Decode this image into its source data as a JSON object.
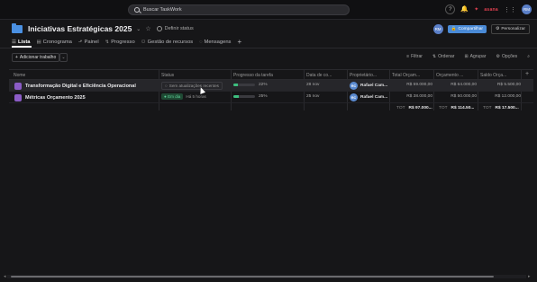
{
  "search": {
    "placeholder": "Buscar TaskWork"
  },
  "topbar": {
    "help": "?",
    "brand": "asana"
  },
  "user": {
    "initials": "RM"
  },
  "project": {
    "title": "Iniciativas Estratégicas 2025",
    "status_label": "Definir status"
  },
  "header_actions": {
    "share": "Compartilhar",
    "customize": "Personalizar"
  },
  "tabs": [
    {
      "label": "Lista",
      "icon": "list-icon"
    },
    {
      "label": "Cronograma",
      "icon": "timeline-icon"
    },
    {
      "label": "Painel",
      "icon": "dashboard-icon"
    },
    {
      "label": "Progresso",
      "icon": "progress-icon"
    },
    {
      "label": "Gestão de recursos",
      "icon": "resources-icon"
    },
    {
      "label": "Mensagens",
      "icon": "messages-icon"
    }
  ],
  "toolbar": {
    "add_work": "Adicionar trabalho",
    "filter": "Filtrar",
    "sort": "Ordenar",
    "group": "Agrupar",
    "options": "Opções"
  },
  "columns": {
    "name": "Nome",
    "status": "Status",
    "progress": "Progresso da tarefa",
    "date": "Data de co...",
    "owner": "Proprietário...",
    "total_budget": "Total Orçam...",
    "budget": "Orçamento ...",
    "balance": "Saldo Orça..."
  },
  "rows": [
    {
      "name": "Transformação Digital e Eficiência Operacional",
      "status": "Sem atualizações recentes",
      "progress": "22%",
      "progress_value": 22,
      "date": "28 nov",
      "owner_initials": "RC",
      "owner": "Rafael Cam...",
      "total_budget": "R$ 59.000,00",
      "budget": "R$ 64.000,00",
      "balance": "R$ 5.500,00"
    },
    {
      "name": "Métricas Orçamento 2025",
      "status_badge": "Em dia",
      "status_time": "Há 5 horas",
      "progress": "25%",
      "progress_value": 25,
      "date": "25 nov",
      "owner_initials": "RC",
      "owner": "Rafael Cam...",
      "total_budget": "R$ 38.000,00",
      "budget": "R$ 50.000,00",
      "balance": "R$ 12.000,00"
    }
  ],
  "totals": {
    "label": "TOT",
    "total_budget": "R$ 97.000...",
    "budget": "R$ 114.50...",
    "balance": "R$ 17.500..."
  },
  "colors": {
    "accent": "#4a8ad6",
    "on_track": "#3dbf7f",
    "project_icon": "#8b5cc6"
  }
}
